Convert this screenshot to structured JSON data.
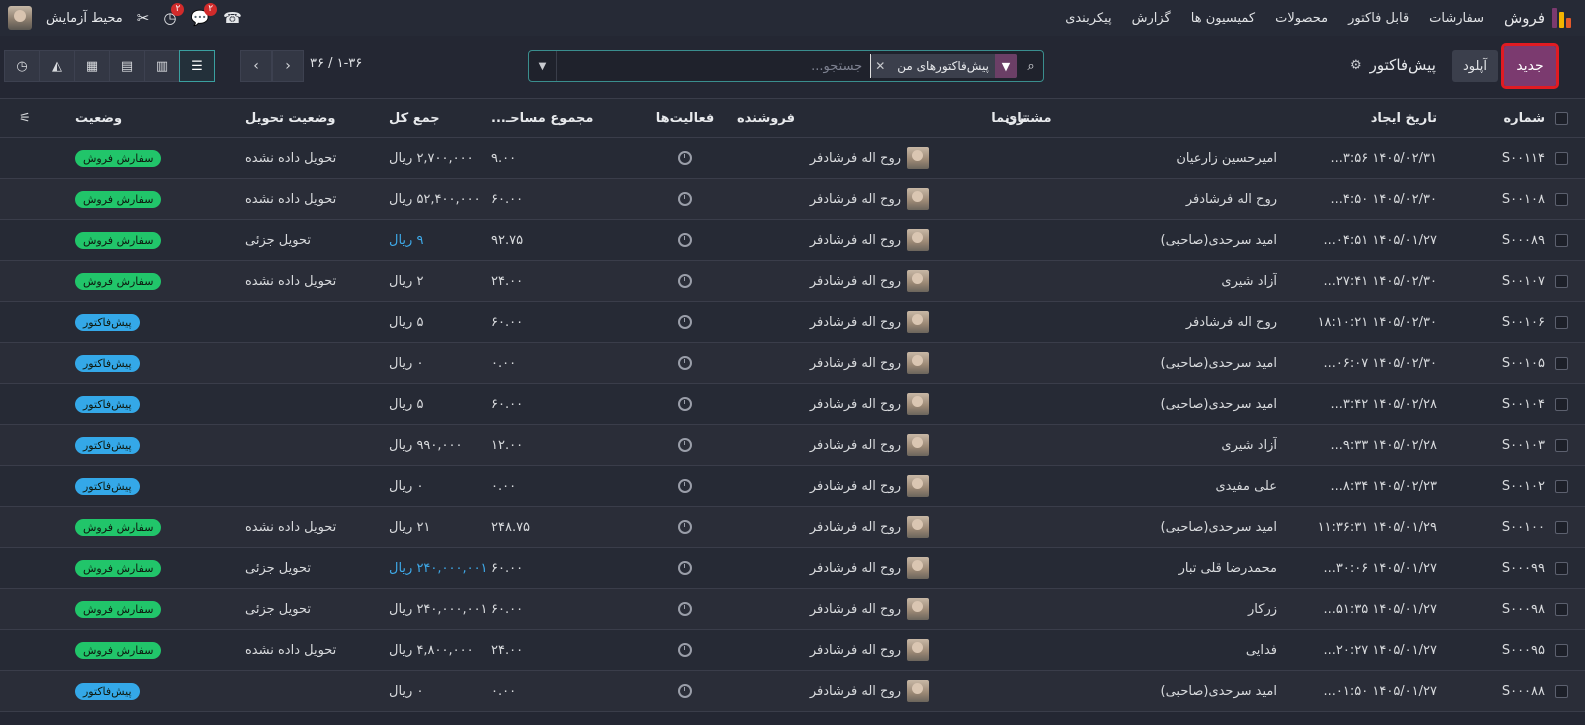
{
  "navbar": {
    "app_name": "فروش",
    "menu": [
      "سفارشات",
      "قابل فاکتور",
      "محصولات",
      "کمیسیون ها",
      "گزارش",
      "پیکربندی"
    ],
    "company": "محیط آزمایش",
    "chat_badge": "۲",
    "activity_badge": "۲",
    "logo_colors": [
      "#e45a2a",
      "#f4b400",
      "#7b3a6f"
    ]
  },
  "control": {
    "new_label": "جدید",
    "upload_label": "آپلود",
    "breadcrumb": "پیش‌فاکتور",
    "facet_label": "پیش‌فاکتورهای من",
    "search_placeholder": "جستجو...",
    "pager_text": "۱-۳۶ / ۳۶"
  },
  "columns": {
    "number": "شماره",
    "date": "تاریخ ایجاد",
    "customer": "مشتری",
    "tarnama": "تارنما",
    "seller": "فروشنده",
    "activities": "فعالیت‌ها",
    "area": "مجموع مساحـ...",
    "total": "جمع کل",
    "delivery": "وضعیت تحویل",
    "status": "وضعیت"
  },
  "rows": [
    {
      "number": "S۰۰۱۱۴",
      "date": "۱۴۰۵/۰۲/۳۱ ۳:۵۶...",
      "customer": "امیرحسین زارعیان",
      "seller": "روح اله فرشادفر",
      "area": "۹.۰۰",
      "total": "۲,۷۰۰,۰۰۰ ریال",
      "delivery": "تحویل داده نشده",
      "status": "سفارش فروش",
      "status_type": "sale",
      "total_link": false
    },
    {
      "number": "S۰۰۱۰۸",
      "date": "۱۴۰۵/۰۲/۳۰ ۴:۵۰...",
      "customer": "روح اله فرشادفر",
      "seller": "روح اله فرشادفر",
      "area": "۶۰.۰۰",
      "total": "۵۲,۴۰۰,۰۰۰ ریال",
      "delivery": "تحویل داده نشده",
      "status": "سفارش فروش",
      "status_type": "sale",
      "total_link": false
    },
    {
      "number": "S۰۰۰۸۹",
      "date": "۱۴۰۵/۰۱/۲۷ ۰۴:۵۱...",
      "customer": "امید سرحدی(صاحبی)",
      "seller": "روح اله فرشادفر",
      "area": "۹۲.۷۵",
      "total": "۹ ریال",
      "delivery": "تحویل جزئی",
      "status": "سفارش فروش",
      "status_type": "sale",
      "total_link": true
    },
    {
      "number": "S۰۰۱۰۷",
      "date": "۱۴۰۵/۰۲/۳۰ ۲۷:۴۱...",
      "customer": "آزاد شیری",
      "seller": "روح اله فرشادفر",
      "area": "۲۴.۰۰",
      "total": "۲ ریال",
      "delivery": "تحویل داده نشده",
      "status": "سفارش فروش",
      "status_type": "sale",
      "total_link": false
    },
    {
      "number": "S۰۰۱۰۶",
      "date": "۱۴۰۵/۰۲/۳۰ ۱۸:۱۰:۲۱",
      "customer": "روح اله فرشادفر",
      "seller": "روح اله فرشادفر",
      "area": "۶۰.۰۰",
      "total": "۵ ریال",
      "delivery": "",
      "status": "پیش‌فاکتور",
      "status_type": "quote",
      "total_link": false
    },
    {
      "number": "S۰۰۱۰۵",
      "date": "۱۴۰۵/۰۲/۳۰ ۰۶:۰۷...",
      "customer": "امید سرحدی(صاحبی)",
      "seller": "روح اله فرشادفر",
      "area": "۰.۰۰",
      "total": "۰ ریال",
      "delivery": "",
      "status": "پیش‌فاکتور",
      "status_type": "quote",
      "total_link": false
    },
    {
      "number": "S۰۰۱۰۴",
      "date": "۱۴۰۵/۰۲/۲۸ ۳:۴۲...",
      "customer": "امید سرحدی(صاحبی)",
      "seller": "روح اله فرشادفر",
      "area": "۶۰.۰۰",
      "total": "۵ ریال",
      "delivery": "",
      "status": "پیش‌فاکتور",
      "status_type": "quote",
      "total_link": false
    },
    {
      "number": "S۰۰۱۰۳",
      "date": "۱۴۰۵/۰۲/۲۸ ۹:۳۳...",
      "customer": "آزاد شیری",
      "seller": "روح اله فرشادفر",
      "area": "۱۲.۰۰",
      "total": "۹۹۰,۰۰۰ ریال",
      "delivery": "",
      "status": "پیش‌فاکتور",
      "status_type": "quote",
      "total_link": false
    },
    {
      "number": "S۰۰۱۰۲",
      "date": "۱۴۰۵/۰۲/۲۳ ۸:۳۴...",
      "customer": "علی مفیدی",
      "seller": "روح اله فرشادفر",
      "area": "۰.۰۰",
      "total": "۰ ریال",
      "delivery": "",
      "status": "پیش‌فاکتور",
      "status_type": "quote",
      "total_link": false
    },
    {
      "number": "S۰۰۱۰۰",
      "date": "۱۴۰۵/۰۱/۲۹ ۱۱:۳۶:۳۱",
      "customer": "امید سرحدی(صاحبی)",
      "seller": "روح اله فرشادفر",
      "area": "۲۴۸.۷۵",
      "total": "۲۱ ریال",
      "delivery": "تحویل داده نشده",
      "status": "سفارش فروش",
      "status_type": "sale",
      "total_link": false
    },
    {
      "number": "S۰۰۰۹۹",
      "date": "۱۴۰۵/۰۱/۲۷ ۳۰:۰۶...",
      "customer": "محمدرضا قلی تبار",
      "seller": "روح اله فرشادفر",
      "area": "۶۰.۰۰",
      "total": "۲۴۰,۰۰۰,۰۰۱ ریال",
      "delivery": "تحویل جزئی",
      "status": "سفارش فروش",
      "status_type": "sale",
      "total_link": true
    },
    {
      "number": "S۰۰۰۹۸",
      "date": "۱۴۰۵/۰۱/۲۷ ۵۱:۳۵...",
      "customer": "زرکار",
      "seller": "روح اله فرشادفر",
      "area": "۶۰.۰۰",
      "total": "۲۴۰,۰۰۰,۰۰۱ ریال",
      "delivery": "تحویل جزئی",
      "status": "سفارش فروش",
      "status_type": "sale",
      "total_link": false
    },
    {
      "number": "S۰۰۰۹۵",
      "date": "۱۴۰۵/۰۱/۲۷ ۲۰:۲۷...",
      "customer": "فدایی",
      "seller": "روح اله فرشادفر",
      "area": "۲۴.۰۰",
      "total": "۴,۸۰۰,۰۰۰ ریال",
      "delivery": "تحویل داده نشده",
      "status": "سفارش فروش",
      "status_type": "sale",
      "total_link": false
    },
    {
      "number": "S۰۰۰۸۸",
      "date": "۱۴۰۵/۰۱/۲۷ ۰۱:۵۰...",
      "customer": "امید سرحدی(صاحبی)",
      "seller": "روح اله فرشادفر",
      "area": "۰.۰۰",
      "total": "۰ ریال",
      "delivery": "",
      "status": "پیش‌فاکتور",
      "status_type": "quote",
      "total_link": false
    }
  ]
}
